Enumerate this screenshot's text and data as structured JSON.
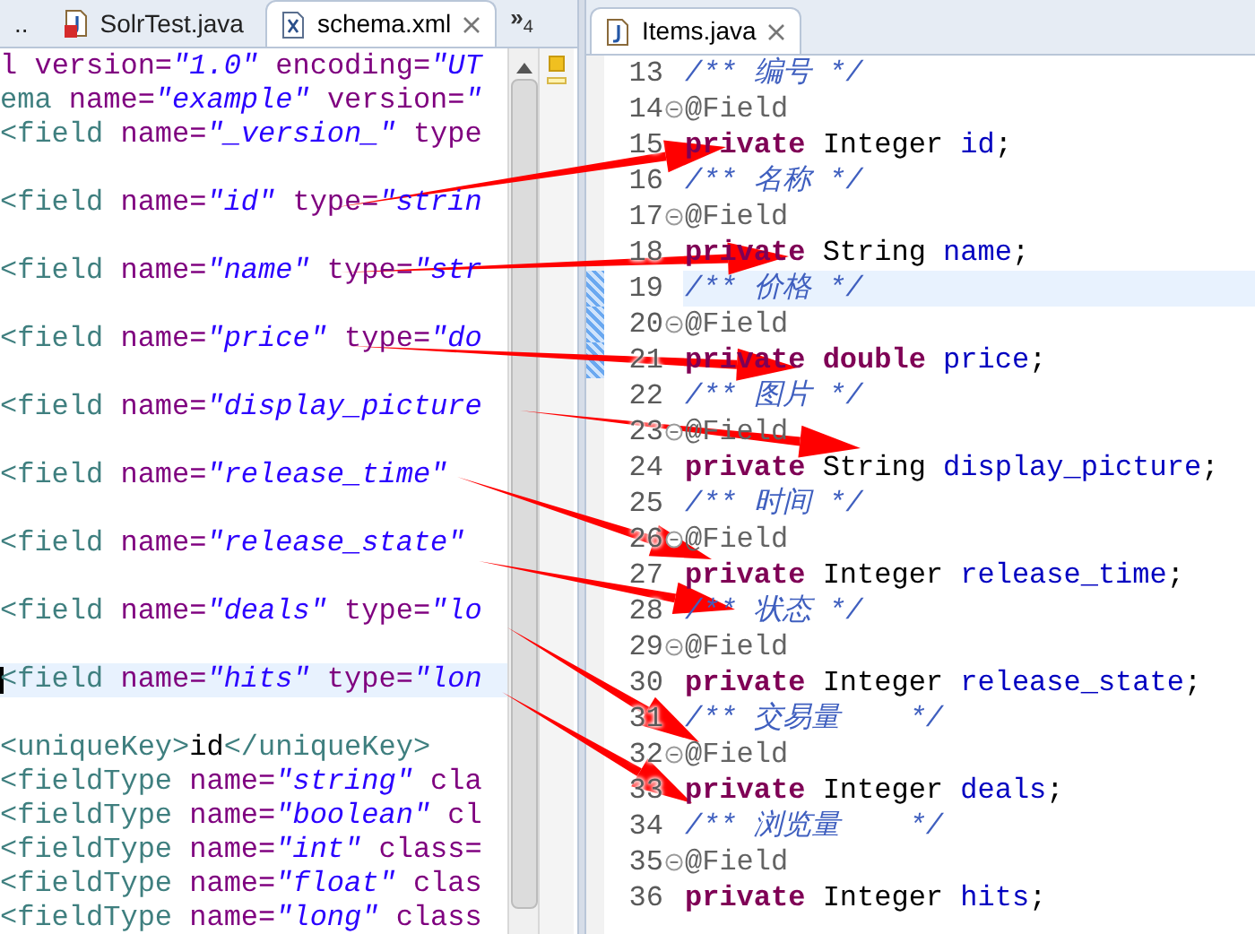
{
  "left_editor": {
    "tabs": [
      {
        "label": "..",
        "selected": false
      },
      {
        "label": "SolrTest.java",
        "selected": false
      },
      {
        "label": "schema.xml",
        "selected": true
      }
    ],
    "overflow": {
      "arrows": "»",
      "count": "4"
    },
    "lines": [
      {
        "current": false,
        "tokens": [
          {
            "kind": "attr",
            "text": "l"
          },
          {
            "kind": "attr",
            "text": " version="
          },
          {
            "kind": "value",
            "text": "\"1.0\""
          },
          {
            "kind": "attr",
            "text": " encoding="
          },
          {
            "kind": "value",
            "text": "\"UT"
          }
        ]
      },
      {
        "current": false,
        "tokens": [
          {
            "kind": "tag",
            "text": "ema"
          },
          {
            "kind": "attr",
            "text": " name="
          },
          {
            "kind": "value",
            "text": "\"example\""
          },
          {
            "kind": "attr",
            "text": " version="
          },
          {
            "kind": "value",
            "text": "\""
          }
        ]
      },
      {
        "current": false,
        "tokens": [
          {
            "kind": "tag",
            "text": "<field"
          },
          {
            "kind": "attr",
            "text": " name="
          },
          {
            "kind": "value",
            "text": "\"_version_\""
          },
          {
            "kind": "attr",
            "text": " type"
          }
        ]
      },
      {
        "current": false
      },
      {
        "current": false,
        "tokens": [
          {
            "kind": "tag",
            "text": "<field"
          },
          {
            "kind": "attr",
            "text": " name="
          },
          {
            "kind": "value",
            "text": "\"id\""
          },
          {
            "kind": "attr",
            "text": " type="
          },
          {
            "kind": "value",
            "text": "\"strin"
          }
        ]
      },
      {
        "current": false
      },
      {
        "current": false,
        "tokens": [
          {
            "kind": "tag",
            "text": "<field"
          },
          {
            "kind": "attr",
            "text": " name="
          },
          {
            "kind": "value",
            "text": "\"name\""
          },
          {
            "kind": "attr",
            "text": " type="
          },
          {
            "kind": "value",
            "text": "\"str"
          }
        ]
      },
      {
        "current": false
      },
      {
        "current": false,
        "tokens": [
          {
            "kind": "tag",
            "text": "<field"
          },
          {
            "kind": "attr",
            "text": " name="
          },
          {
            "kind": "value",
            "text": "\"price\""
          },
          {
            "kind": "attr",
            "text": " type="
          },
          {
            "kind": "value",
            "text": "\"do"
          }
        ]
      },
      {
        "current": false
      },
      {
        "current": false,
        "tokens": [
          {
            "kind": "tag",
            "text": "<field"
          },
          {
            "kind": "attr",
            "text": " name="
          },
          {
            "kind": "value",
            "text": "\"display_picture"
          }
        ]
      },
      {
        "current": false
      },
      {
        "current": false,
        "tokens": [
          {
            "kind": "tag",
            "text": "<field"
          },
          {
            "kind": "attr",
            "text": " name="
          },
          {
            "kind": "value",
            "text": "\"release_time\""
          }
        ]
      },
      {
        "current": false
      },
      {
        "current": false,
        "tokens": [
          {
            "kind": "tag",
            "text": "<field"
          },
          {
            "kind": "attr",
            "text": " name="
          },
          {
            "kind": "value",
            "text": "\"release_state\""
          }
        ]
      },
      {
        "current": false
      },
      {
        "current": false,
        "tokens": [
          {
            "kind": "tag",
            "text": "<field"
          },
          {
            "kind": "attr",
            "text": " name="
          },
          {
            "kind": "value",
            "text": "\"deals\""
          },
          {
            "kind": "attr",
            "text": " type="
          },
          {
            "kind": "value",
            "text": "\"lo"
          }
        ]
      },
      {
        "current": false
      },
      {
        "current": true,
        "tokens": [
          {
            "kind": "tag",
            "text": "<field"
          },
          {
            "kind": "attr",
            "text": " name="
          },
          {
            "kind": "value",
            "text": "\"hits\""
          },
          {
            "kind": "attr",
            "text": " type="
          },
          {
            "kind": "value",
            "text": "\"lon"
          }
        ]
      },
      {
        "current": false
      },
      {
        "current": false,
        "tokens": [
          {
            "kind": "tag",
            "text": "<uniqueKey>"
          },
          {
            "kind": "text",
            "text": "id"
          },
          {
            "kind": "tag",
            "text": "</uniqueKey>"
          }
        ]
      },
      {
        "current": false,
        "tokens": [
          {
            "kind": "tag",
            "text": "<fieldType"
          },
          {
            "kind": "attr",
            "text": " name="
          },
          {
            "kind": "value",
            "text": "\"string\""
          },
          {
            "kind": "attr",
            "text": " cla"
          }
        ]
      },
      {
        "current": false,
        "tokens": [
          {
            "kind": "tag",
            "text": "<fieldType"
          },
          {
            "kind": "attr",
            "text": " name="
          },
          {
            "kind": "value",
            "text": "\"boolean\""
          },
          {
            "kind": "attr",
            "text": " cl"
          }
        ]
      },
      {
        "current": false,
        "tokens": [
          {
            "kind": "tag",
            "text": "<fieldType"
          },
          {
            "kind": "attr",
            "text": " name="
          },
          {
            "kind": "value",
            "text": "\"int\""
          },
          {
            "kind": "attr",
            "text": " class="
          }
        ]
      },
      {
        "current": false,
        "tokens": [
          {
            "kind": "tag",
            "text": "<fieldType"
          },
          {
            "kind": "attr",
            "text": " name="
          },
          {
            "kind": "value",
            "text": "\"float\""
          },
          {
            "kind": "attr",
            "text": " clas"
          }
        ]
      },
      {
        "current": false,
        "tokens": [
          {
            "kind": "tag",
            "text": "<fieldType"
          },
          {
            "kind": "attr",
            "text": " name="
          },
          {
            "kind": "value",
            "text": "\"long\""
          },
          {
            "kind": "attr",
            "text": " class"
          }
        ]
      }
    ]
  },
  "right_editor": {
    "tabs": [
      {
        "label": "Items.java",
        "selected": true
      }
    ],
    "lines": [
      {
        "number": "13",
        "fold": false,
        "changed": false,
        "current": false,
        "tokens": [
          {
            "kind": "comment",
            "text": "/** 编号 */"
          }
        ]
      },
      {
        "number": "14",
        "fold": true,
        "changed": false,
        "current": false,
        "tokens": [
          {
            "kind": "annotation",
            "text": "@Field"
          }
        ]
      },
      {
        "number": "15",
        "fold": false,
        "changed": false,
        "current": false,
        "tokens": [
          {
            "kind": "keyword",
            "text": "private"
          },
          {
            "kind": "plain",
            "text": " Integer "
          },
          {
            "kind": "field",
            "text": "id"
          },
          {
            "kind": "plain",
            "text": ";"
          }
        ]
      },
      {
        "number": "16",
        "fold": false,
        "changed": false,
        "current": false,
        "tokens": [
          {
            "kind": "comment",
            "text": "/** 名称 */"
          }
        ]
      },
      {
        "number": "17",
        "fold": true,
        "changed": false,
        "current": false,
        "tokens": [
          {
            "kind": "annotation",
            "text": "@Field"
          }
        ]
      },
      {
        "number": "18",
        "fold": false,
        "changed": false,
        "current": false,
        "tokens": [
          {
            "kind": "keyword",
            "text": "private"
          },
          {
            "kind": "plain",
            "text": " String "
          },
          {
            "kind": "field",
            "text": "name"
          },
          {
            "kind": "plain",
            "text": ";"
          }
        ]
      },
      {
        "number": "19",
        "fold": false,
        "changed": true,
        "current": true,
        "tokens": [
          {
            "kind": "comment",
            "text": "/** 价格 */"
          }
        ]
      },
      {
        "number": "20",
        "fold": true,
        "changed": true,
        "current": false,
        "tokens": [
          {
            "kind": "annotation",
            "text": "@Field"
          }
        ]
      },
      {
        "number": "21",
        "fold": false,
        "changed": true,
        "current": false,
        "tokens": [
          {
            "kind": "keyword",
            "text": "private"
          },
          {
            "kind": "keyword",
            "text": " double"
          },
          {
            "kind": "field",
            "text": " price"
          },
          {
            "kind": "plain",
            "text": ";"
          }
        ]
      },
      {
        "number": "22",
        "fold": false,
        "changed": false,
        "current": false,
        "tokens": [
          {
            "kind": "comment",
            "text": "/** 图片 */"
          }
        ]
      },
      {
        "number": "23",
        "fold": true,
        "changed": false,
        "current": false,
        "tokens": [
          {
            "kind": "annotation",
            "text": "@Field"
          }
        ]
      },
      {
        "number": "24",
        "fold": false,
        "changed": false,
        "current": false,
        "tokens": [
          {
            "kind": "keyword",
            "text": "private"
          },
          {
            "kind": "plain",
            "text": " String "
          },
          {
            "kind": "field",
            "text": "display_picture"
          },
          {
            "kind": "plain",
            "text": ";"
          }
        ]
      },
      {
        "number": "25",
        "fold": false,
        "changed": false,
        "current": false,
        "tokens": [
          {
            "kind": "comment",
            "text": "/** 时间 */"
          }
        ]
      },
      {
        "number": "26",
        "fold": true,
        "changed": false,
        "current": false,
        "tokens": [
          {
            "kind": "annotation",
            "text": "@Field"
          }
        ]
      },
      {
        "number": "27",
        "fold": false,
        "changed": false,
        "current": false,
        "tokens": [
          {
            "kind": "keyword",
            "text": "private"
          },
          {
            "kind": "plain",
            "text": " Integer "
          },
          {
            "kind": "field",
            "text": "release_time"
          },
          {
            "kind": "plain",
            "text": ";"
          }
        ]
      },
      {
        "number": "28",
        "fold": false,
        "changed": false,
        "current": false,
        "tokens": [
          {
            "kind": "comment",
            "text": "/** 状态 */"
          }
        ]
      },
      {
        "number": "29",
        "fold": true,
        "changed": false,
        "current": false,
        "tokens": [
          {
            "kind": "annotation",
            "text": "@Field"
          }
        ]
      },
      {
        "number": "30",
        "fold": false,
        "changed": false,
        "current": false,
        "tokens": [
          {
            "kind": "keyword",
            "text": "private"
          },
          {
            "kind": "plain",
            "text": " Integer "
          },
          {
            "kind": "field",
            "text": "release_state"
          },
          {
            "kind": "plain",
            "text": ";"
          }
        ]
      },
      {
        "number": "31",
        "fold": false,
        "changed": false,
        "current": false,
        "tokens": [
          {
            "kind": "comment",
            "text": "/** 交易量    */"
          }
        ]
      },
      {
        "number": "32",
        "fold": true,
        "changed": false,
        "current": false,
        "tokens": [
          {
            "kind": "annotation",
            "text": "@Field"
          }
        ]
      },
      {
        "number": "33",
        "fold": false,
        "changed": false,
        "current": false,
        "tokens": [
          {
            "kind": "keyword",
            "text": "private"
          },
          {
            "kind": "plain",
            "text": " Integer "
          },
          {
            "kind": "field",
            "text": "deals"
          },
          {
            "kind": "plain",
            "text": ";"
          }
        ]
      },
      {
        "number": "34",
        "fold": false,
        "changed": false,
        "current": false,
        "tokens": [
          {
            "kind": "comment",
            "text": "/** 浏览量    */"
          }
        ]
      },
      {
        "number": "35",
        "fold": true,
        "changed": false,
        "current": false,
        "tokens": [
          {
            "kind": "annotation",
            "text": "@Field"
          }
        ]
      },
      {
        "number": "36",
        "fold": false,
        "changed": false,
        "current": false,
        "tokens": [
          {
            "kind": "keyword",
            "text": "private"
          },
          {
            "kind": "plain",
            "text": " Integer "
          },
          {
            "kind": "field",
            "text": "hits"
          },
          {
            "kind": "plain",
            "text": ";"
          }
        ]
      }
    ]
  }
}
